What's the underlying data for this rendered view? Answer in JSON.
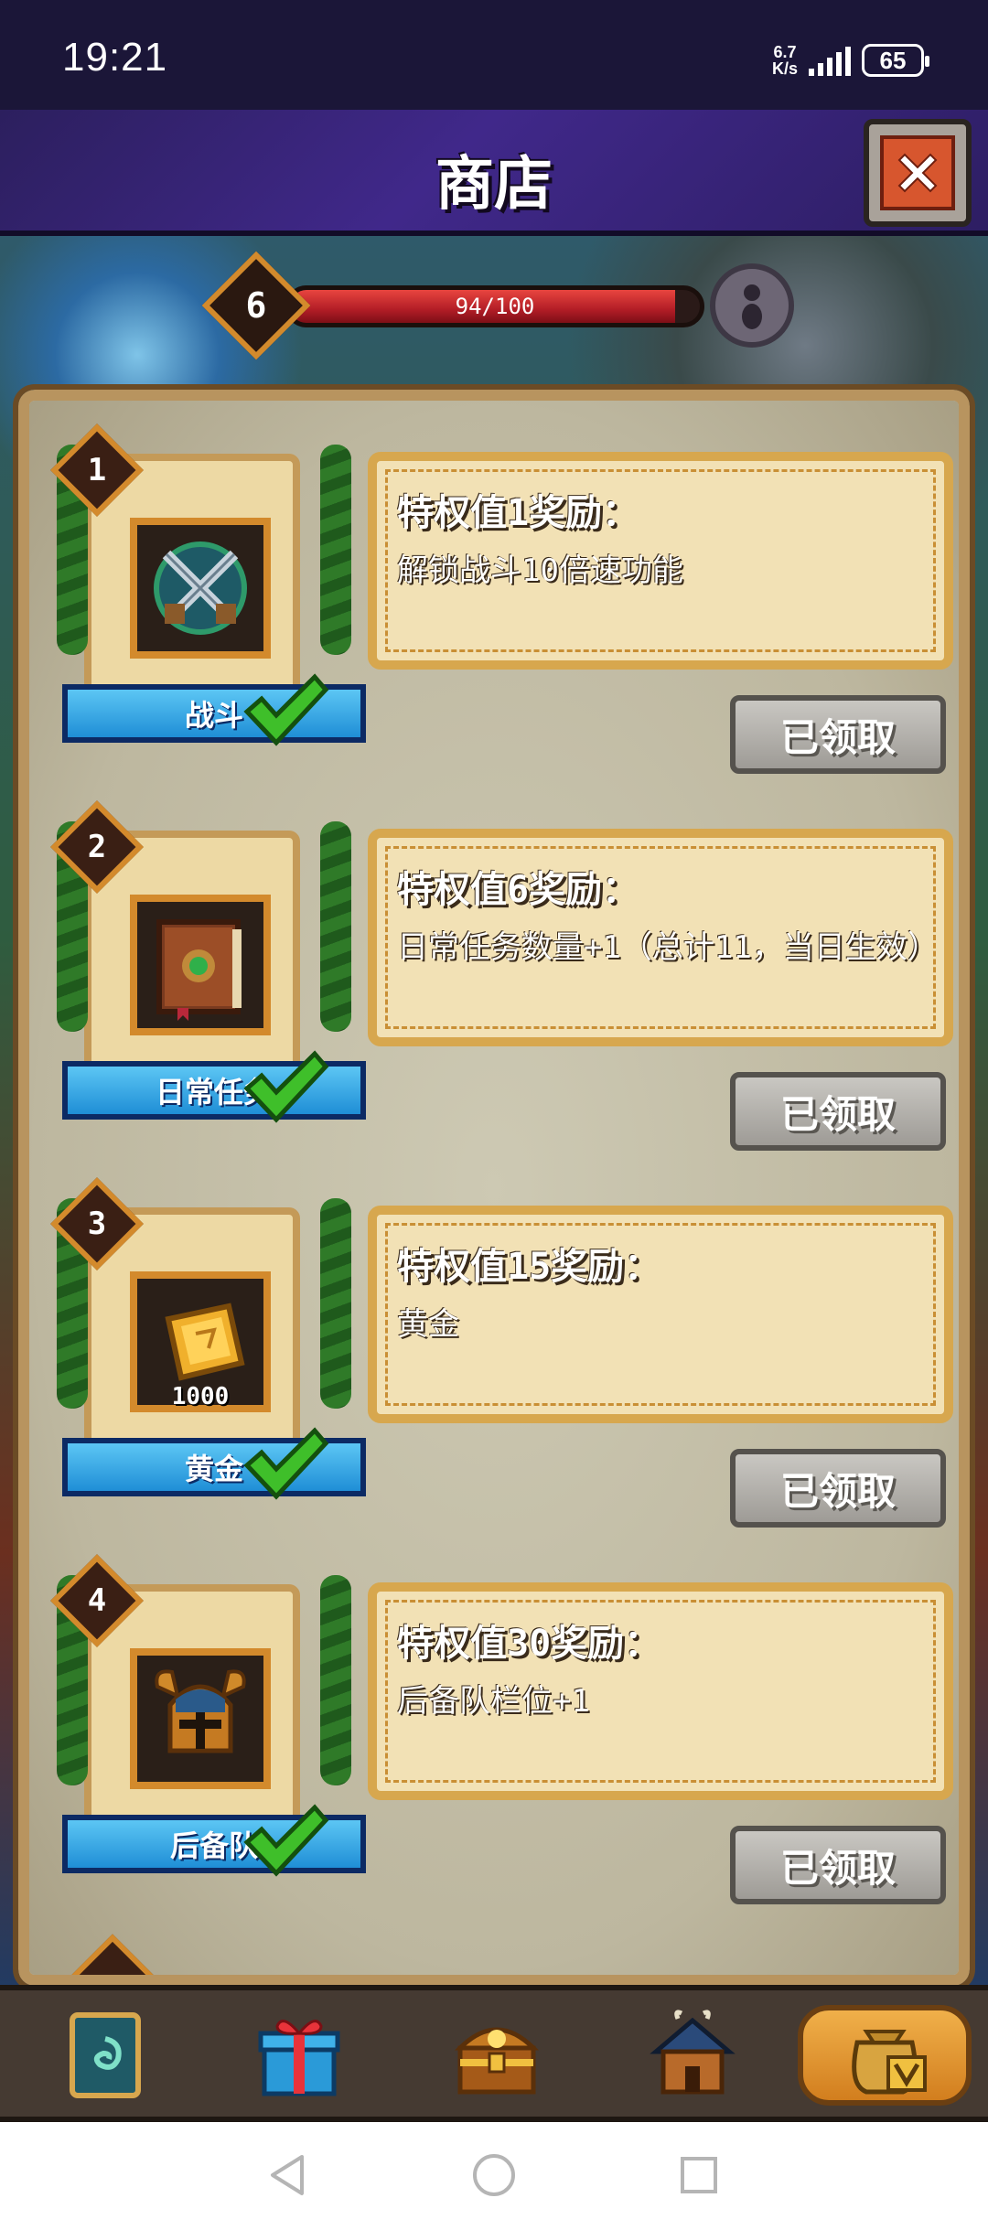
{
  "status_bar": {
    "time": "19:21",
    "net_speed_value": "6.7",
    "net_speed_unit": "K/s",
    "battery": "65"
  },
  "header": {
    "title": "商店"
  },
  "level": {
    "value": "6",
    "progress_text": "94/100",
    "progress_current": 94,
    "progress_max": 100
  },
  "rewards": [
    {
      "rank": "1",
      "item_label": "战斗",
      "title": "特权值1奖励：",
      "description": "解锁战斗10倍速功能",
      "button": "已领取",
      "icon": "crossed-swords-icon",
      "claimed": true
    },
    {
      "rank": "2",
      "item_label": "日常任务",
      "title": "特权值6奖励：",
      "description": "日常任务数量+1（总计11，当日生效）",
      "button": "已领取",
      "icon": "quest-book-icon",
      "claimed": true
    },
    {
      "rank": "3",
      "item_label": "黄金",
      "quantity": "1000",
      "title": "特权值15奖励：",
      "description": "黄金",
      "button": "已领取",
      "icon": "gold-bar-icon",
      "claimed": true
    },
    {
      "rank": "4",
      "item_label": "后备队",
      "title": "特权值30奖励：",
      "description": "后备队栏位+1",
      "button": "已领取",
      "icon": "knight-helmet-icon",
      "claimed": true
    }
  ],
  "bottom_nav": [
    {
      "icon": "card-icon",
      "active": false
    },
    {
      "icon": "gift-box-icon",
      "active": false
    },
    {
      "icon": "treasure-chest-icon",
      "active": false
    },
    {
      "icon": "barracks-icon",
      "active": false
    },
    {
      "icon": "money-bag-vip-icon",
      "active": true
    }
  ],
  "colors": {
    "header_bg": "#40288a",
    "progress_fill": "#b21d26",
    "banner_blue": "#1f8ed6",
    "gold_frame": "#d38a2c",
    "check_green": "#3fbf2a"
  }
}
